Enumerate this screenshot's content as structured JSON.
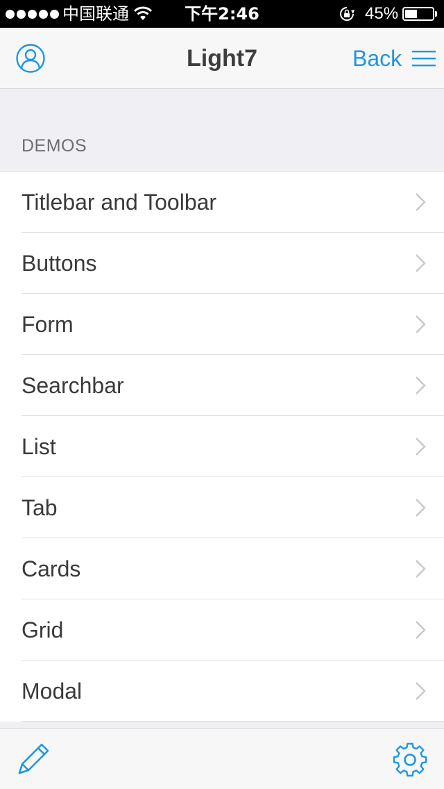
{
  "status_bar": {
    "carrier": "中国联通",
    "time": "下午2:46",
    "battery_text": "45%",
    "battery_level": 0.45,
    "signal_dots": 5,
    "wifi_icon": "wifi-icon",
    "lock_icon": "rotation-lock-icon"
  },
  "navbar": {
    "title": "Light7",
    "back_label": "Back",
    "left_icon": "user-profile-icon",
    "right_icon": "menu-icon"
  },
  "section": {
    "header": "DEMOS"
  },
  "demos": [
    {
      "label": "Titlebar and Toolbar"
    },
    {
      "label": "Buttons"
    },
    {
      "label": "Form"
    },
    {
      "label": "Searchbar"
    },
    {
      "label": "List"
    },
    {
      "label": "Tab"
    },
    {
      "label": "Cards"
    },
    {
      "label": "Grid"
    },
    {
      "label": "Modal"
    }
  ],
  "toolbar": {
    "left_icon": "edit-pencil-icon",
    "right_icon": "settings-gear-icon"
  },
  "colors": {
    "accent": "#1e96e0",
    "statusbar_bg": "#000000",
    "navbar_bg": "#f7f7f8",
    "page_bg": "#efeff4",
    "text_primary": "#3a3a3a",
    "section_text": "#6d6d72"
  }
}
